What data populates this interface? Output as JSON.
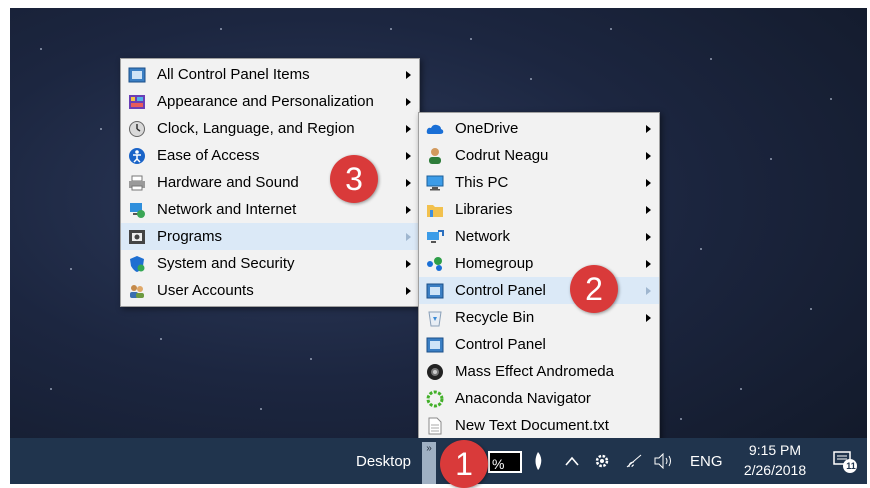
{
  "menu_main": {
    "items": [
      {
        "label": "All Control Panel Items",
        "icon": "control-panel-icon"
      },
      {
        "label": "Appearance and Personalization",
        "icon": "appearance-icon"
      },
      {
        "label": "Clock, Language, and Region",
        "icon": "clock-icon"
      },
      {
        "label": "Ease of Access",
        "icon": "ease-of-access-icon"
      },
      {
        "label": "Hardware and Sound",
        "icon": "printer-icon"
      },
      {
        "label": "Network and Internet",
        "icon": "network-globe-icon"
      },
      {
        "label": "Programs",
        "icon": "programs-icon"
      },
      {
        "label": "System and Security",
        "icon": "shield-icon"
      },
      {
        "label": "User Accounts",
        "icon": "users-icon"
      }
    ]
  },
  "menu_desktop": {
    "items": [
      {
        "label": "OneDrive",
        "icon": "onedrive-icon"
      },
      {
        "label": "Codrut Neagu",
        "icon": "user-icon"
      },
      {
        "label": "This PC",
        "icon": "monitor-icon"
      },
      {
        "label": "Libraries",
        "icon": "folder-icon"
      },
      {
        "label": "Network",
        "icon": "network-icon"
      },
      {
        "label": "Homegroup",
        "icon": "homegroup-icon"
      },
      {
        "label": "Control Panel",
        "icon": "control-panel-icon"
      },
      {
        "label": "Recycle Bin",
        "icon": "recycle-bin-icon"
      },
      {
        "label": "Control Panel",
        "icon": "control-panel-icon"
      },
      {
        "label": "Mass Effect Andromeda",
        "icon": "game-icon"
      },
      {
        "label": "Anaconda Navigator",
        "icon": "anaconda-icon"
      },
      {
        "label": "New Text Document.txt",
        "icon": "text-file-icon"
      }
    ]
  },
  "badges": {
    "one": "1",
    "two": "2",
    "three": "3"
  },
  "taskbar": {
    "desktop_label": "Desktop",
    "chevron": "»",
    "box_text": "%",
    "language": "ENG",
    "time": "9:15 PM",
    "date": "2/26/2018",
    "notification_count": "11"
  },
  "colors": {
    "badge": "#d93a3a",
    "taskbar": "#20344d",
    "highlight": "#dbe9f7"
  }
}
